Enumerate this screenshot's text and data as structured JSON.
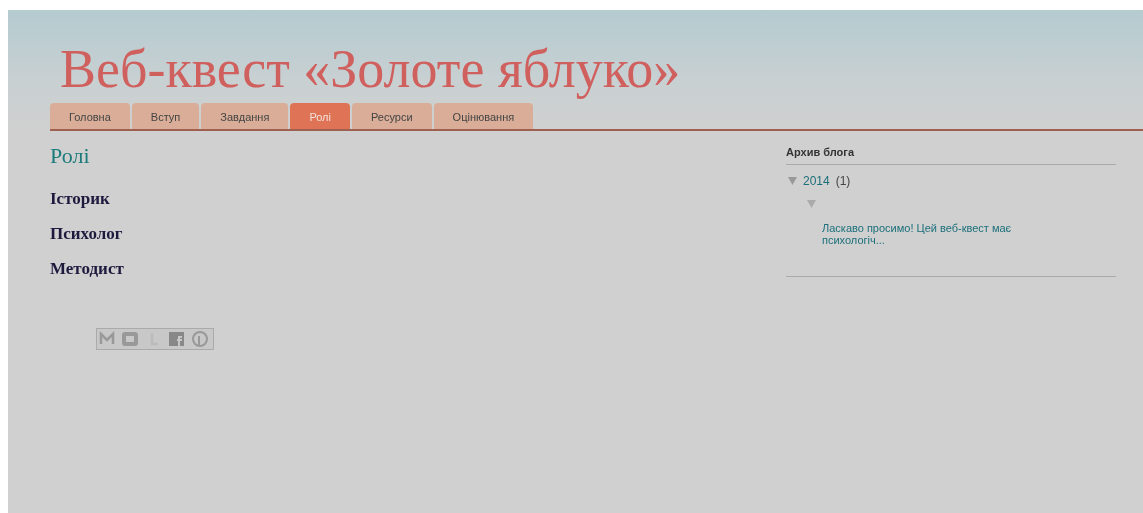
{
  "blog_title": "Веб-квест «Золоте яблуко»",
  "tabs": [
    {
      "label": "Головна",
      "selected": false
    },
    {
      "label": "Вступ",
      "selected": false
    },
    {
      "label": "Завдання",
      "selected": false
    },
    {
      "label": "Ролі",
      "selected": true
    },
    {
      "label": "Ресурси",
      "selected": false
    },
    {
      "label": "Оцінювання",
      "selected": false
    }
  ],
  "post": {
    "title": "Ролі",
    "roles": [
      "Історик",
      "Психолог",
      "Методист"
    ]
  },
  "archive": {
    "title": "Архив блога",
    "years": [
      {
        "label": "2014",
        "count": "(1)",
        "expanded": true,
        "children": [
          {
            "expanded": true,
            "posts": [
              "Ласкаво просимо! Цей веб-квест має психологіч..."
            ]
          }
        ]
      }
    ]
  }
}
